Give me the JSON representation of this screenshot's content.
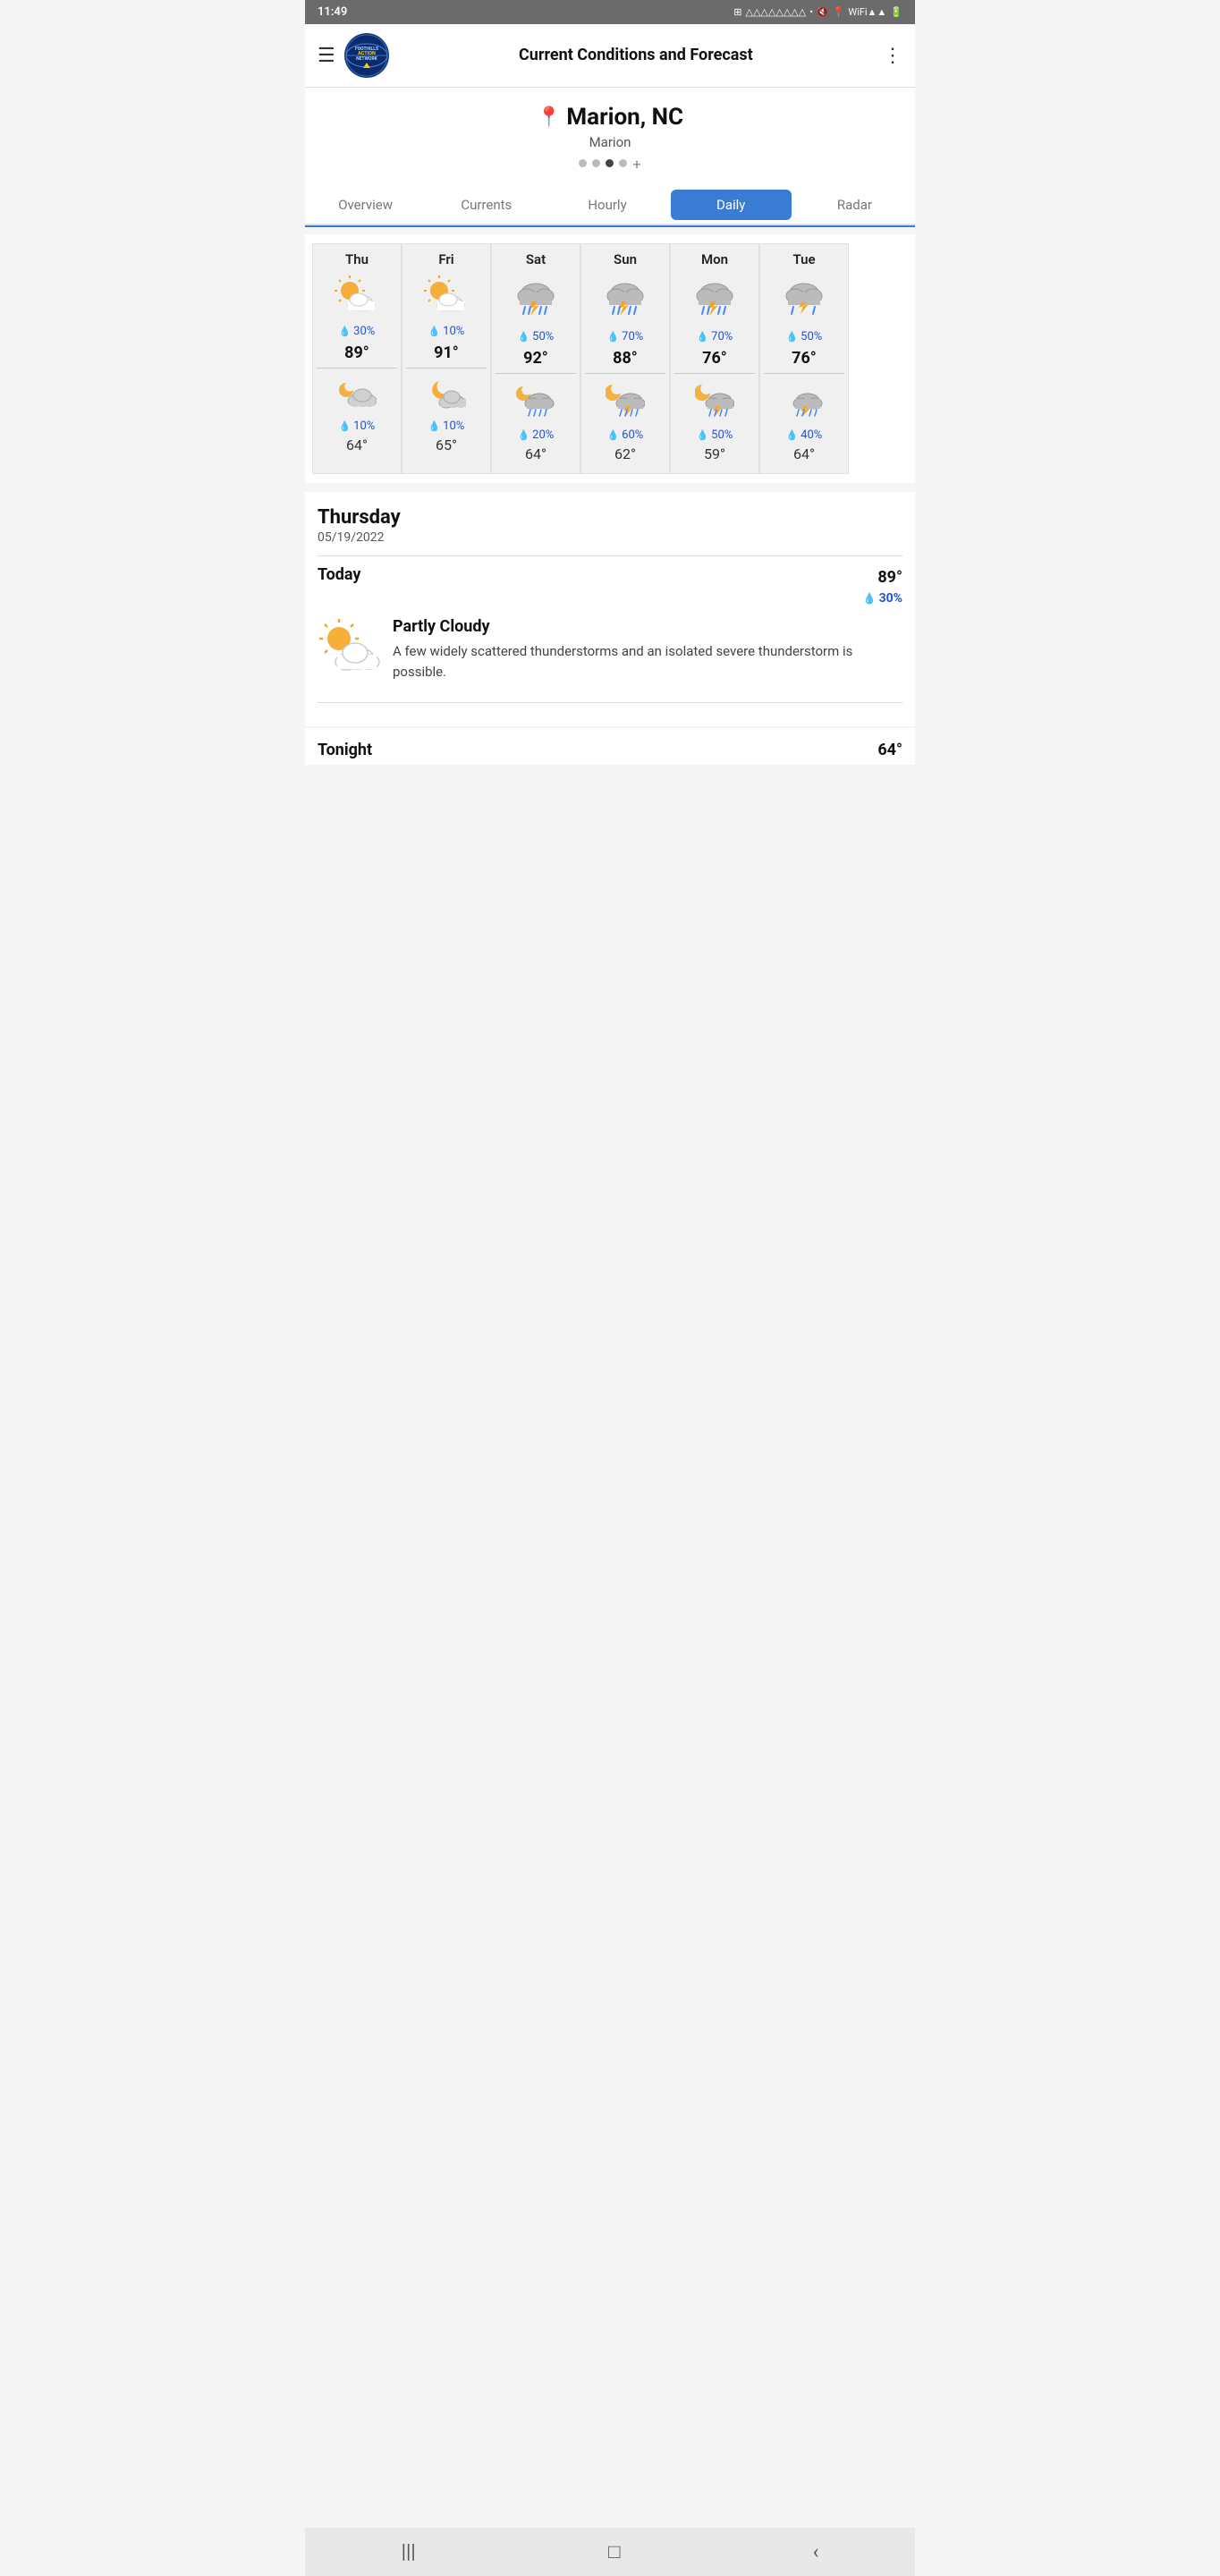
{
  "statusBar": {
    "time": "11:49",
    "icons": "⊞ △ △ △ △ △ △ △ △ • 🔇 📍 WiFi ▲▲▲ 🔋"
  },
  "appBar": {
    "menuLabel": "☰",
    "logoText": "FOOTHILLS ACTION NETWORK",
    "title": "Current Conditions and Forecast",
    "moreLabel": "⋮"
  },
  "location": {
    "pin": "📍",
    "city": "Marion, NC",
    "sub": "Marion",
    "dots": [
      "",
      "",
      "active",
      "",
      ""
    ],
    "plusLabel": "+"
  },
  "tabs": [
    {
      "label": "Overview",
      "active": false
    },
    {
      "label": "Currents",
      "active": false
    },
    {
      "label": "Hourly",
      "active": false
    },
    {
      "label": "Daily",
      "active": true
    },
    {
      "label": "Radar",
      "active": false
    }
  ],
  "dailyForecast": [
    {
      "day": "Thu",
      "dayIcon": "partly-cloudy-day",
      "rainPct": "30%",
      "highTemp": "89°",
      "nightIcon": "night-cloudy",
      "nightRainPct": "10%",
      "lowTemp": "64°"
    },
    {
      "day": "Fri",
      "dayIcon": "partly-cloudy-day",
      "rainPct": "10%",
      "highTemp": "91°",
      "nightIcon": "night-moon-cloudy",
      "nightRainPct": "10%",
      "lowTemp": "65°"
    },
    {
      "day": "Sat",
      "dayIcon": "thunderstorm",
      "rainPct": "50%",
      "highTemp": "92°",
      "nightIcon": "night-thunderstorm",
      "nightRainPct": "20%",
      "lowTemp": "64°"
    },
    {
      "day": "Sun",
      "dayIcon": "thunderstorm",
      "rainPct": "70%",
      "highTemp": "88°",
      "nightIcon": "night-thunderstorm",
      "nightRainPct": "60%",
      "lowTemp": "62°"
    },
    {
      "day": "Mon",
      "dayIcon": "thunderstorm",
      "rainPct": "70%",
      "highTemp": "76°",
      "nightIcon": "night-thunderstorm",
      "nightRainPct": "50%",
      "lowTemp": "59°"
    },
    {
      "day": "Tue",
      "dayIcon": "thunderstorm-cloud",
      "rainPct": "50%",
      "highTemp": "76°",
      "nightIcon": "night-thunderstorm",
      "nightRainPct": "40%",
      "lowTemp": "64°"
    }
  ],
  "detail": {
    "dayName": "Thursday",
    "date": "05/19/2022",
    "today": {
      "label": "Today",
      "highTemp": "89°",
      "rainPct": "30%",
      "condition": "Partly Cloudy",
      "description": "A few widely scattered thunderstorms and an isolated severe thunderstorm is possible."
    },
    "tonight": {
      "label": "Tonight",
      "lowTemp": "64°"
    }
  },
  "bottomNav": {
    "menuBtn": "|||",
    "homeBtn": "□",
    "backBtn": "<"
  }
}
